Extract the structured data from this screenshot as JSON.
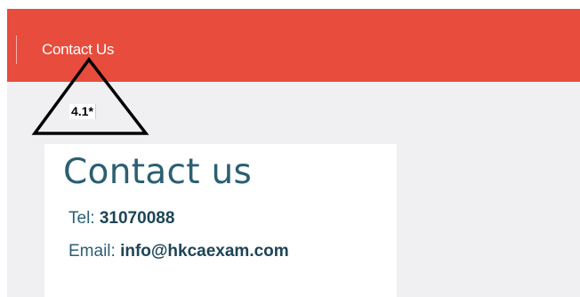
{
  "nav": {
    "contact_link": "Contact Us",
    "background_color": "#e74c3c"
  },
  "annotation": {
    "label": "4.1*",
    "shape": "triangle-outline"
  },
  "contact_card": {
    "title": "Contact us",
    "tel_label": "Tel:",
    "tel_value": "31070088",
    "email_label": "Email:",
    "email_value": "info@hkcaexam.com",
    "text_color": "#2c5f72"
  },
  "page": {
    "content_background": "#f0eff1"
  }
}
